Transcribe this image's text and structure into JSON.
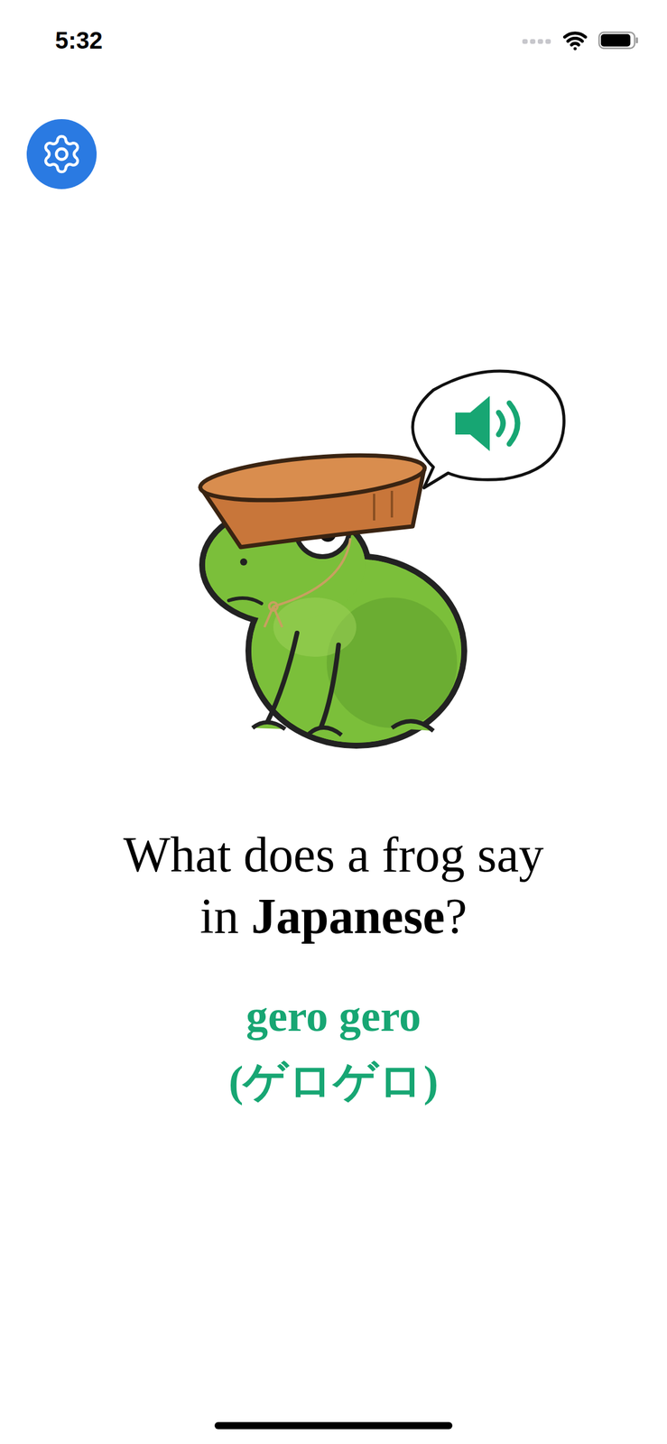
{
  "status_bar": {
    "time": "5:32",
    "signal": {
      "level": 0
    },
    "wifi": {
      "on": true
    },
    "battery": {
      "level": 0.92
    }
  },
  "settings_button": {
    "label_hidden": false
  },
  "illustration": {
    "sound_button": {
      "playing": false
    }
  },
  "question": {
    "line1": "What does a frog say",
    "line2_before": "in ",
    "emphasis": "Japanese",
    "after": "?"
  },
  "answer": {
    "romaji": "gero gero",
    "kana": "(ゲロゲロ)",
    "color": "#17a673"
  }
}
